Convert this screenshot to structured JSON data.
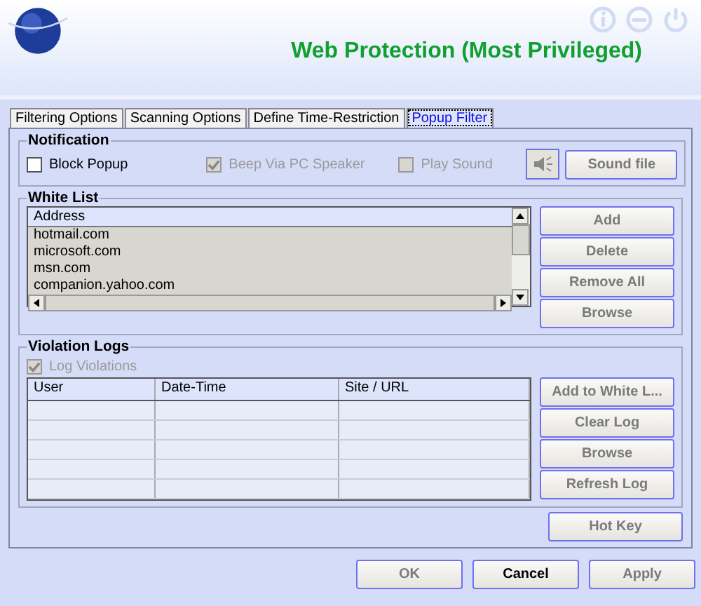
{
  "header": {
    "title": "Web Protection (Most Privileged)"
  },
  "tabs": [
    {
      "label": "Filtering Options",
      "selected": false
    },
    {
      "label": "Scanning Options",
      "selected": false
    },
    {
      "label": "Define Time-Restriction",
      "selected": false
    },
    {
      "label": "Popup Filter",
      "selected": true
    }
  ],
  "notification": {
    "title": "Notification",
    "options": [
      {
        "label": "Block Popup",
        "checked": false,
        "disabled": false
      },
      {
        "label": "Beep Via PC Speaker",
        "checked": true,
        "disabled": true
      },
      {
        "label": "Play Sound",
        "checked": false,
        "disabled": true
      }
    ],
    "sound_button": {
      "label": "Sound file",
      "disabled": true
    }
  },
  "white_list": {
    "title": "White List",
    "column": "Address",
    "rows": [
      "hotmail.com",
      "microsoft.com",
      "msn.com",
      "companion.yahoo.com"
    ],
    "buttons": [
      {
        "label": "Add",
        "disabled": true
      },
      {
        "label": "Delete",
        "disabled": true
      },
      {
        "label": "Remove All",
        "disabled": true
      },
      {
        "label": "Browse",
        "disabled": true
      }
    ]
  },
  "violation_logs": {
    "title": "Violation Logs",
    "log_option": {
      "label": "Log Violations",
      "checked": true,
      "disabled": true
    },
    "columns": [
      "User",
      "Date-Time",
      "Site / URL"
    ],
    "buttons": [
      {
        "label": "Add to White L...",
        "disabled": true
      },
      {
        "label": "Clear Log",
        "disabled": true
      },
      {
        "label": "Browse",
        "disabled": true
      },
      {
        "label": "Refresh Log",
        "disabled": true
      }
    ]
  },
  "hot_key": {
    "label": "Hot Key",
    "disabled": true
  },
  "footer_buttons": [
    {
      "label": "OK",
      "disabled": true
    },
    {
      "label": "Cancel",
      "disabled": false
    },
    {
      "label": "Apply",
      "disabled": true
    }
  ]
}
